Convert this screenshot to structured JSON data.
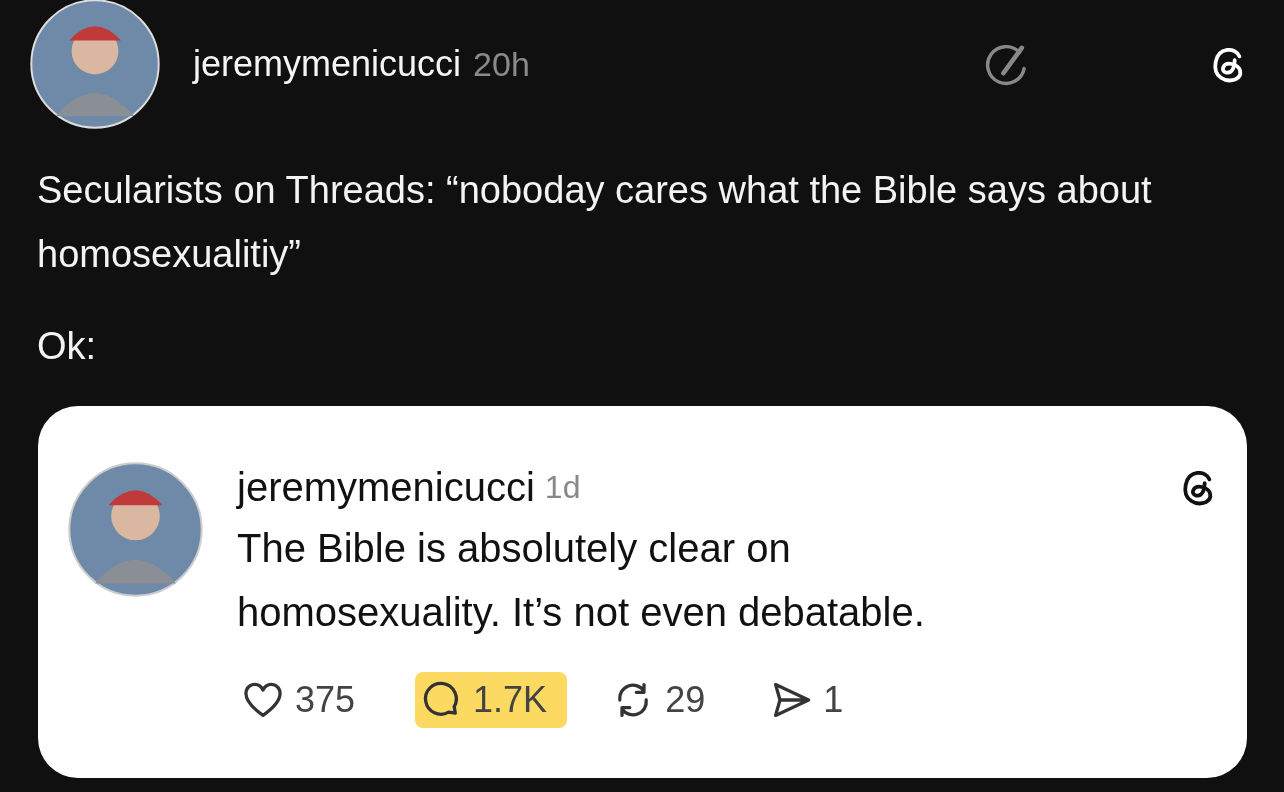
{
  "post": {
    "author": "jeremymenicucci",
    "time": "20h",
    "text": [
      "Secularists on Threads: “noboday cares what the Bible says about homosexualitiy”",
      "Ok:"
    ]
  },
  "quoted_post": {
    "author": "jeremymenicucci",
    "time": "1d",
    "text": "The Bible is absolutely clear on homosexuality. It’s not even debatable.",
    "actions": [
      {
        "kind": "like",
        "count": "375",
        "highlighted": false
      },
      {
        "kind": "reply",
        "count": "1.7K",
        "highlighted": true
      },
      {
        "kind": "repost",
        "count": "29",
        "highlighted": false
      },
      {
        "kind": "share",
        "count": "1",
        "highlighted": false
      }
    ]
  }
}
